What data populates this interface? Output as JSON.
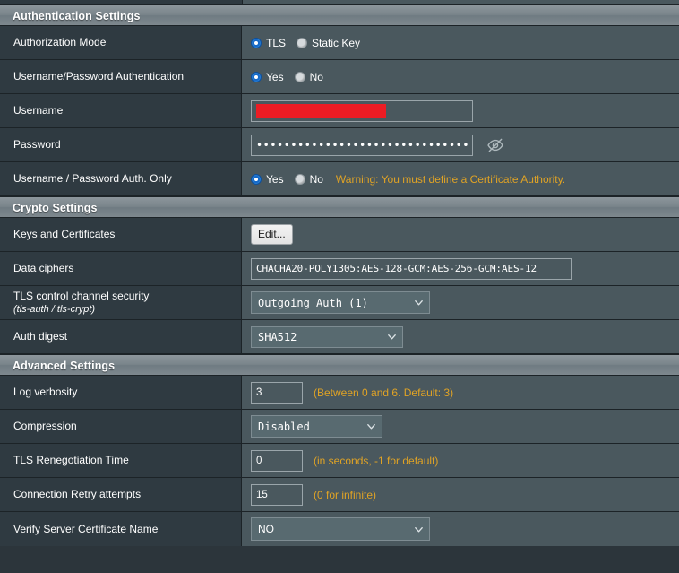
{
  "sections": [
    {
      "id": "auth",
      "title": "Authentication Settings",
      "rows": [
        {
          "label": "Authorization Mode",
          "type": "radio",
          "options": [
            {
              "label": "TLS",
              "selected": true
            },
            {
              "label": "Static Key",
              "selected": false
            }
          ]
        },
        {
          "label": "Username/Password Authentication",
          "type": "radio",
          "options": [
            {
              "label": "Yes",
              "selected": true
            },
            {
              "label": "No",
              "selected": false
            }
          ]
        },
        {
          "label": "Username",
          "type": "text-redacted",
          "value": ""
        },
        {
          "label": "Password",
          "type": "password",
          "value": "•••••••••••••••••••••••••••••••",
          "reveal_icon": "eye-slash-icon"
        },
        {
          "label": "Username / Password Auth. Only",
          "type": "radio-warning",
          "options": [
            {
              "label": "Yes",
              "selected": true
            },
            {
              "label": "No",
              "selected": false
            }
          ],
          "warning": "Warning: You must define a Certificate Authority."
        }
      ]
    },
    {
      "id": "crypto",
      "title": "Crypto Settings",
      "rows": [
        {
          "label": "Keys and Certificates",
          "type": "button",
          "button_label": "Edit..."
        },
        {
          "label": "Data ciphers",
          "type": "text",
          "value": "CHACHA20-POLY1305:AES-128-GCM:AES-256-GCM:AES-12"
        },
        {
          "label": "TLS control channel security",
          "sub_label": "(tls-auth / tls-crypt)",
          "type": "select",
          "value": "Outgoing Auth (1)"
        },
        {
          "label": "Auth digest",
          "type": "select",
          "value": "SHA512"
        }
      ]
    },
    {
      "id": "advanced",
      "title": "Advanced Settings",
      "rows": [
        {
          "label": "Log verbosity",
          "type": "number",
          "value": "3",
          "hint": "(Between 0 and 6. Default: 3)"
        },
        {
          "label": "Compression",
          "type": "select",
          "value": "Disabled"
        },
        {
          "label": "TLS Renegotiation Time",
          "type": "number",
          "value": "0",
          "hint": "(in seconds, -1 for default)"
        },
        {
          "label": "Connection Retry attempts",
          "type": "number",
          "value": "15",
          "hint": "(0 for infinite)"
        },
        {
          "label": "Verify Server Certificate Name",
          "type": "select",
          "value": "NO"
        }
      ]
    }
  ],
  "colors": {
    "label_bg": "#2f3a41",
    "value_bg": "#4a585e",
    "header_bg": "#7e888e",
    "warning": "#e0a325",
    "radio_selected": "#1569c7",
    "redaction": "#ec1c24"
  }
}
